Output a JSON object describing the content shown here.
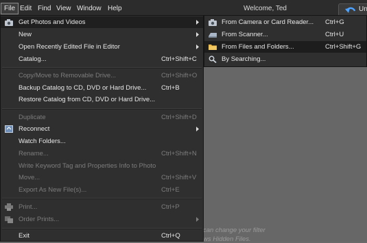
{
  "menubar": {
    "items": [
      "File",
      "Edit",
      "Find",
      "View",
      "Window",
      "Help"
    ],
    "welcome": "Welcome, Ted",
    "undo_label": "Un"
  },
  "background_hints": [
    "can change your filter",
    "ws Hidden Files."
  ],
  "file_menu": {
    "items": [
      {
        "label": "Get Photos and Videos",
        "shortcut": "",
        "submenu": true,
        "enabled": true,
        "icon": "camera-icon"
      },
      {
        "label": "New",
        "shortcut": "",
        "submenu": true,
        "enabled": true
      },
      {
        "label": "Open Recently Edited File in Editor",
        "shortcut": "",
        "submenu": true,
        "enabled": true
      },
      {
        "label": "Catalog...",
        "shortcut": "Ctrl+Shift+C",
        "enabled": true
      },
      {
        "label": "Copy/Move to Removable Drive...",
        "shortcut": "Ctrl+Shift+O",
        "enabled": false
      },
      {
        "label": "Backup Catalog to CD, DVD or Hard Drive...",
        "shortcut": "Ctrl+B",
        "enabled": true
      },
      {
        "label": "Restore Catalog from CD, DVD or Hard Drive...",
        "shortcut": "",
        "enabled": true
      },
      {
        "label": "Duplicate",
        "shortcut": "Ctrl+Shift+D",
        "enabled": false
      },
      {
        "label": "Reconnect",
        "shortcut": "",
        "submenu": true,
        "enabled": true,
        "icon": "reconnect-icon"
      },
      {
        "label": "Watch Folders...",
        "shortcut": "",
        "enabled": true
      },
      {
        "label": "Rename...",
        "shortcut": "Ctrl+Shift+N",
        "enabled": false
      },
      {
        "label": "Write Keyword Tag and Properties Info to Photo",
        "shortcut": "",
        "enabled": false
      },
      {
        "label": "Move...",
        "shortcut": "Ctrl+Shift+V",
        "enabled": false
      },
      {
        "label": "Export As New File(s)...",
        "shortcut": "Ctrl+E",
        "enabled": false
      },
      {
        "label": "Print...",
        "shortcut": "Ctrl+P",
        "enabled": false,
        "icon": "printer-icon"
      },
      {
        "label": "Order Prints...",
        "shortcut": "",
        "submenu": true,
        "enabled": false,
        "icon": "order-prints-icon"
      },
      {
        "label": "Exit",
        "shortcut": "Ctrl+Q",
        "enabled": true
      }
    ]
  },
  "submenu": {
    "items": [
      {
        "label": "From Camera or Card Reader...",
        "shortcut": "Ctrl+G",
        "icon": "camera-icon"
      },
      {
        "label": "From Scanner...",
        "shortcut": "Ctrl+U",
        "icon": "scanner-icon"
      },
      {
        "label": "From Files and Folders...",
        "shortcut": "Ctrl+Shift+G",
        "icon": "folder-icon"
      },
      {
        "label": "By Searching...",
        "shortcut": "",
        "icon": "search-icon"
      }
    ]
  },
  "colors": {
    "menu_bg": "#2f2f2f",
    "highlight": "#1f1f1f",
    "disabled_text": "#7d7d7d",
    "folder": "#e9b84a"
  }
}
